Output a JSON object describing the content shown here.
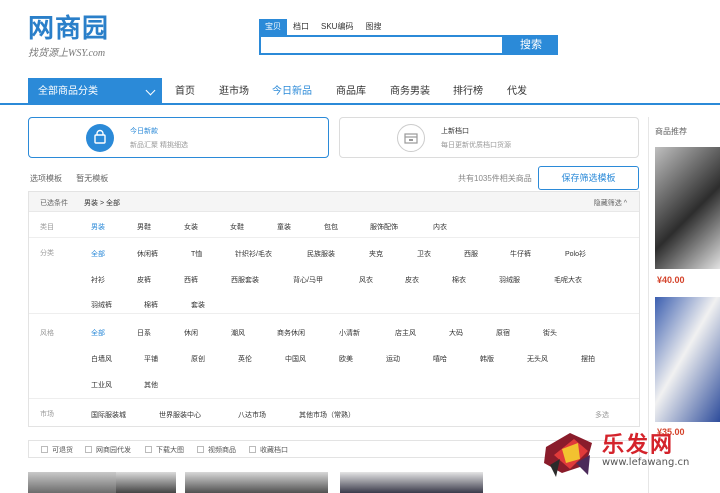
{
  "header": {
    "logo_text": "网商园",
    "logo_slogan": "找货源上WSY.com",
    "search_tabs": [
      "宝贝",
      "档口",
      "SKU编码",
      "图搜"
    ],
    "search_button": "搜索"
  },
  "nav": {
    "all_categories": "全部商品分类",
    "items": [
      "首页",
      "逛市场",
      "今日新品",
      "商品库",
      "商务男装",
      "排行榜",
      "代发"
    ]
  },
  "cards": [
    {
      "title": "今日新款",
      "desc": "新品汇聚 精挑细选"
    },
    {
      "title": "上新档口",
      "desc": "每日更新优质档口货源"
    }
  ],
  "toolbar": {
    "option_template": "选项模板",
    "no_template": "暂无模板",
    "count": "共有1035件相关商品",
    "save_button": "保存筛选模板"
  },
  "filters": {
    "chosen_label": "已选条件",
    "chosen_value": "男装 > 全部",
    "hide_filter": "隐藏筛选 ^",
    "category_label": "类目",
    "category_options": [
      "男装",
      "男鞋",
      "女装",
      "女鞋",
      "童装",
      "包包",
      "服饰配饰",
      "内衣"
    ],
    "class_label": "分类",
    "class_options_row1": [
      "全部",
      "休闲裤",
      "T恤",
      "针织衫/毛衣",
      "民族服装",
      "夹克",
      "卫衣",
      "西服",
      "牛仔裤",
      "Polo衫"
    ],
    "class_options_row2": [
      "衬衫",
      "皮裤",
      "西裤",
      "西服套装",
      "背心/马甲",
      "风衣",
      "皮衣",
      "棉衣",
      "羽绒服",
      "毛呢大衣"
    ],
    "class_options_row3": [
      "羽绒裤",
      "棉裤",
      "套装"
    ],
    "style_label": "风格",
    "style_options_row1": [
      "全部",
      "日系",
      "休闲",
      "潮风",
      "商务休闲",
      "小清新",
      "店主风",
      "大码",
      "原宿",
      "街头"
    ],
    "style_options_row2": [
      "白墙风",
      "平铺",
      "原创",
      "英伦",
      "中国风",
      "欧美",
      "运动",
      "嘻哈",
      "韩版",
      "无头风",
      "摆拍"
    ],
    "style_options_row3": [
      "工业风",
      "其他"
    ],
    "market_label": "市场",
    "market_options": [
      "国际服装城",
      "世界服装中心",
      "八达市场",
      "其他市场（常熟）"
    ],
    "multi_select": "多选"
  },
  "checkboxes": [
    "可退货",
    "网商园代发",
    "下载大图",
    "视频商品",
    "收藏档口"
  ],
  "rail": {
    "title": "商品推荐",
    "price1": "¥40.00",
    "price2": "¥35.00"
  },
  "watermark": {
    "main": "乐发网",
    "url": "www.lefawang.cn"
  },
  "colors": {
    "accent": "#2b8ad8",
    "price": "#d4432b"
  }
}
